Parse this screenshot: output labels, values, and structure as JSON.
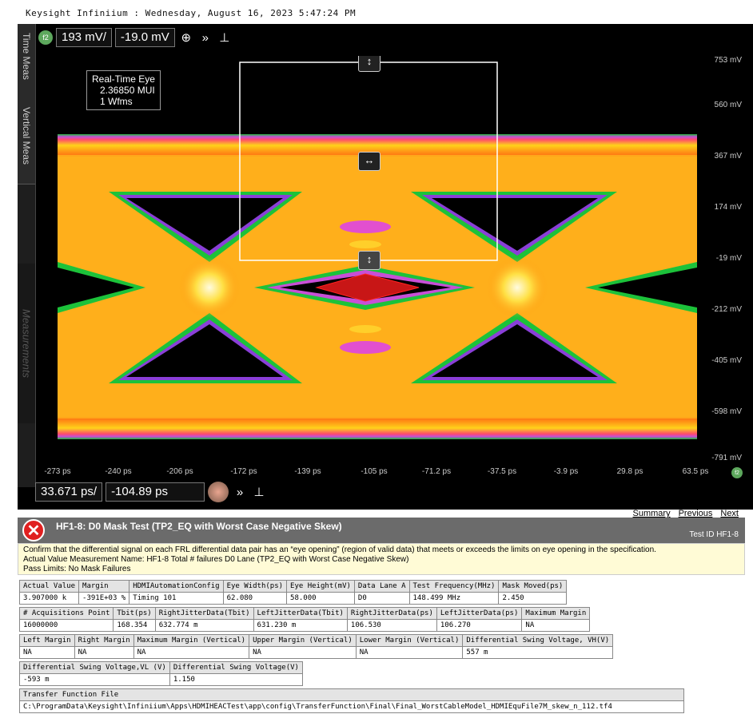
{
  "window_title": "Keysight Infiniium : Wednesday, August 16, 2023 5:47:24 PM",
  "side_tabs": {
    "time": "Time Meas",
    "vertical": "Vertical Meas",
    "measurements": "Measurements"
  },
  "topbar": {
    "channel": "f2",
    "scale": "193 mV/",
    "offset": "-19.0 mV"
  },
  "bottombar": {
    "scale": "33.671 ps/",
    "offset": "-104.89 ps"
  },
  "info_box": {
    "line1": "Real-Time Eye",
    "line2": "2.36850 MUI",
    "line3": "1 Wfms"
  },
  "y_labels": [
    "753 mV",
    "560 mV",
    "367 mV",
    "174 mV",
    "-19 mV",
    "-212 mV",
    "-405 mV",
    "-598 mV",
    "-791 mV"
  ],
  "x_labels": [
    "-273 ps",
    "-240 ps",
    "-206 ps",
    "-172 ps",
    "-139 ps",
    "-105 ps",
    "-71.2 ps",
    "-37.5 ps",
    "-3.9 ps",
    "29.8 ps",
    "63.5 ps"
  ],
  "channel_marker_right": "f2",
  "nav": {
    "summary": "Summary",
    "previous": "Previous",
    "next": "Next"
  },
  "test": {
    "title": "HF1-8: D0 Mask Test (TP2_EQ with Worst Case Negative Skew)",
    "id": "Test ID HF1-8",
    "desc1": "Confirm that the differential signal on each FRL differential data pair has an “eye opening” (region of valid data) that meets or exceeds the limits on eye opening in the specification.",
    "desc2": "Actual Value Measurement Name: HF1-8 Total # failures D0 Lane (TP2_EQ with Worst Case Negative Skew)",
    "desc3": "Pass Limits: No Mask Failures"
  },
  "tables": [
    {
      "headers": [
        "Actual Value",
        "Margin",
        "HDMIAutomationConfig",
        "Eye Width(ps)",
        "Eye Height(mV)",
        "Data Lane A",
        "Test Frequency(MHz)",
        "Mask Moved(ps)"
      ],
      "values": [
        "3.907000 k",
        "-391E+03 %",
        "Timing 101",
        "62.080",
        "58.000",
        "D0",
        "148.499 MHz",
        "2.450"
      ]
    },
    {
      "headers": [
        "# Acquisitions Point",
        "Tbit(ps)",
        "RightJitterData(Tbit)",
        "LeftJitterData(Tbit)",
        "RightJitterData(ps)",
        "LeftJitterData(ps)",
        "Maximum Margin"
      ],
      "values": [
        "16000000",
        "168.354",
        "632.774 m",
        "631.230 m",
        "106.530",
        "106.270",
        "NA"
      ]
    },
    {
      "headers": [
        "Left Margin",
        "Right Margin",
        "Maximum Margin (Vertical)",
        "Upper Margin (Vertical)",
        "Lower Margin (Vertical)",
        "Differential Swing Voltage, VH(V)"
      ],
      "values": [
        "NA",
        "NA",
        "NA",
        "NA",
        "NA",
        "557 m"
      ]
    },
    {
      "headers": [
        "Differential Swing Voltage,VL (V)",
        "Differential Swing Voltage(V)"
      ],
      "values": [
        "-593 m",
        "1.150"
      ]
    },
    {
      "headers": [
        "Transfer Function File"
      ],
      "values": [
        "C:\\ProgramData\\Keysight\\Infiniium\\Apps\\HDMIHEACTest\\app\\config\\TransferFunction\\Final\\Final_WorstCableModel_HDMIEquFile7M_skew_n_112.tf4"
      ]
    }
  ]
}
